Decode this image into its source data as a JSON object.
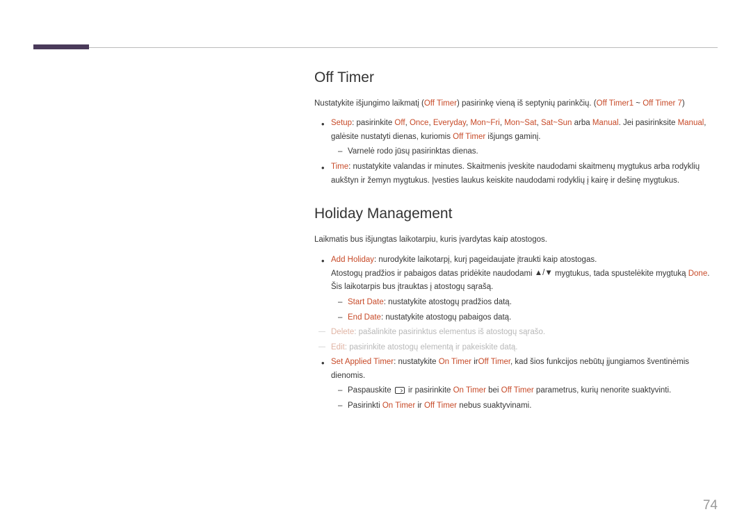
{
  "page_number": "74",
  "sections": {
    "off_timer": {
      "heading": "Off Timer",
      "intro_pre": "Nustatykite išjungimo laikmatį (",
      "intro_hl1": "Off Timer",
      "intro_mid": ") pasirinkę vieną iš septynių parinkčių. (",
      "intro_hl2": "Off Timer1",
      "intro_sep": " ~ ",
      "intro_hl3": "Off Timer 7",
      "intro_post": ")",
      "setup": {
        "label": "Setup",
        "pre": ": pasirinkite ",
        "opts": [
          "Off",
          "Once",
          "Everyday",
          "Mon~Fri",
          "Mon~Sat",
          "Sat~Sun"
        ],
        "arba": " arba ",
        "manual": "Manual",
        "post1": ". Jei pasirinksite ",
        "post2": ", galėsite nustatyti dienas, kuriomis ",
        "off_timer": "Off Timer",
        "post3": " išjungs gaminį."
      },
      "checkmark_note": "Varnelė rodo jūsų pasirinktas dienas.",
      "time": {
        "label": "Time",
        "text": ": nustatykite valandas ir minutes. Skaitmenis įveskite naudodami skaitmenų mygtukus arba rodyklių aukštyn ir žemyn mygtukus. Įvesties laukus keiskite naudodami rodyklių į kairę ir dešinę mygtukus."
      }
    },
    "holiday": {
      "heading": "Holiday Management",
      "intro": "Laikmatis bus išjungtas laikotarpiu, kuris įvardytas kaip atostogos.",
      "add_holiday": {
        "label": "Add Holiday",
        "text": ": nurodykite laikotarpį, kurį pageidaujate įtraukti kaip atostogas.",
        "line2_pre": "Atostogų pradžios ir pabaigos datas pridėkite naudodami ",
        "line2_post": " mygtukus, tada spustelėkite mygtuką ",
        "done": "Done",
        "line2_end": ".",
        "line3": "Šis laikotarpis bus įtrauktas į atostogų sąrašą."
      },
      "start_date": {
        "label": "Start Date",
        "text": ": nustatykite atostogų pradžios datą."
      },
      "end_date": {
        "label": "End Date",
        "text": ": nustatykite atostogų pabaigos datą."
      },
      "delete": {
        "label": "Delete",
        "text": ": pašalinkite pasirinktus elementus iš atostogų sąrašo."
      },
      "edit": {
        "label": "Edit",
        "text": ": pasirinkite atostogų elementą ir pakeiskite datą."
      },
      "set_applied": {
        "label": "Set Applied Timer",
        "pre": ": nustatykite ",
        "on_timer": "On Timer",
        "ir": " ir",
        "off_timer": "Off Timer",
        "post": ", kad šios funkcijos nebūtų įjungiamos šventinėmis dienomis.",
        "sub1_pre": "Paspauskite ",
        "sub1_mid": " ir pasirinkite ",
        "sub1_bei": " bei ",
        "sub1_post": " parametrus, kurių nenorite suaktyvinti.",
        "sub2_pre": "Pasirinkti ",
        "sub2_ir": " ir ",
        "sub2_post": " nebus suaktyvinami."
      }
    }
  }
}
